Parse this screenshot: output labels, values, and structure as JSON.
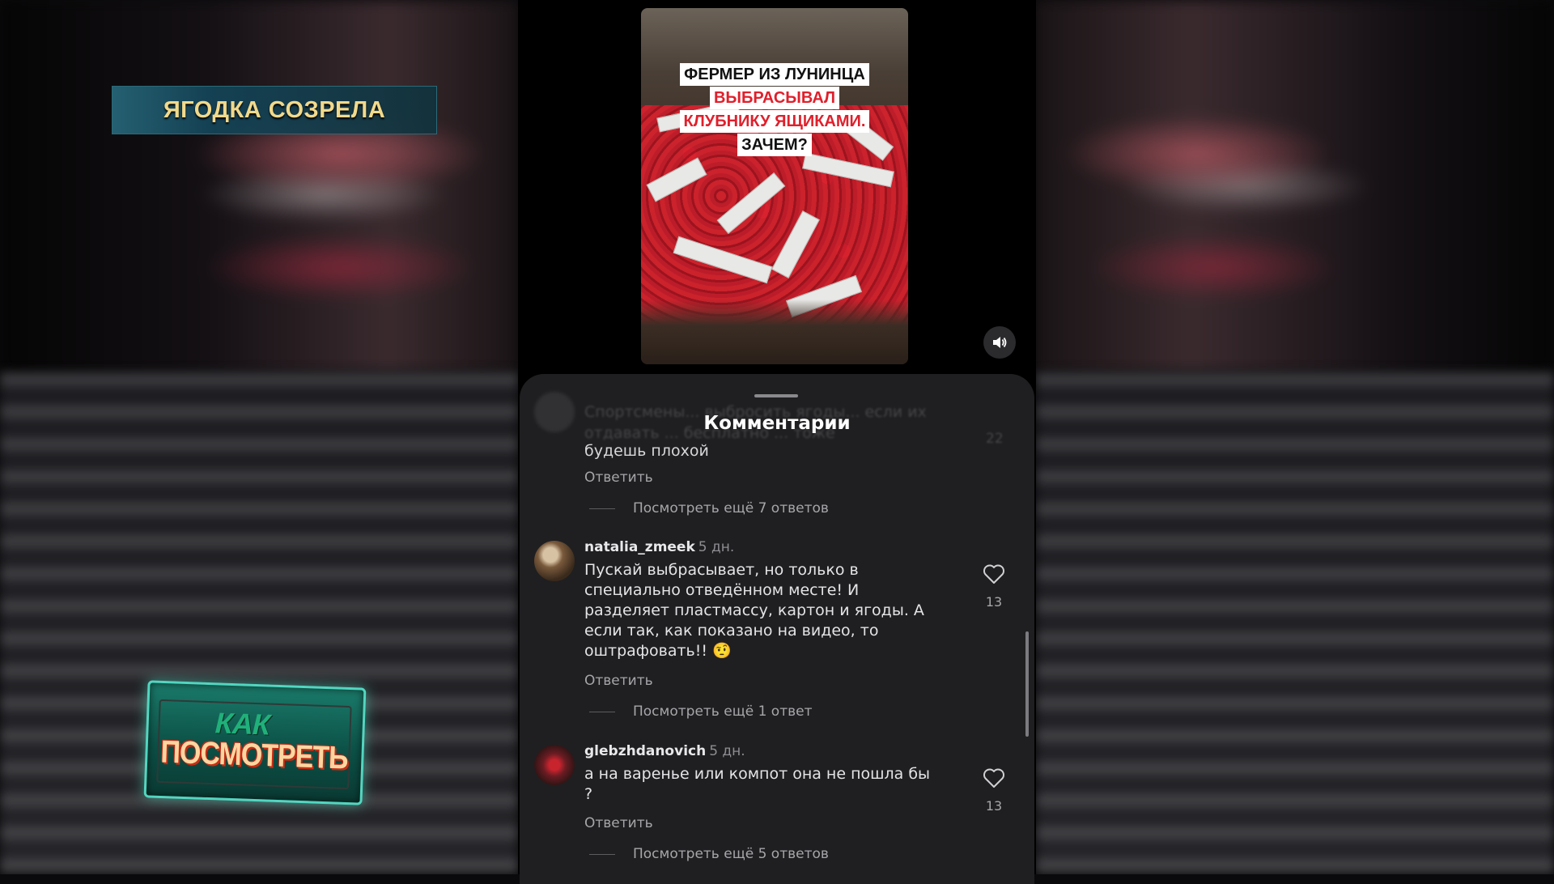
{
  "overlay": {
    "banner_text": "ЯГОДКА СОЗРЕЛА",
    "logo_top": "КАК",
    "logo_bottom": "ПОСМОТРЕТЬ"
  },
  "video": {
    "caption_line1": "ФЕРМЕР ИЗ ЛУНИНЦА",
    "caption_line2": "ВЫБРАСЫВАЛ",
    "caption_line3": "КЛУБНИКУ ЯЩИКАМИ.",
    "caption_line4": "ЗАЧЕМ?",
    "sound_icon": "speaker-icon"
  },
  "comments_sheet": {
    "title": "Комментарии",
    "prev_comment": {
      "faded_text": "Спортсмены... выбросить ягоды... если их отдавать ... бесплатно ... тоже",
      "visible_tail": "будешь плохой",
      "likes": "22",
      "reply_label": "Ответить",
      "more_replies": "Посмотреть ещё 7 ответов"
    },
    "comments": [
      {
        "username": "natalia_zmeek",
        "time": "5 дн.",
        "text": "Пускай выбрасывает, но только в специально отведённом месте!  И разделяет пластмассу, картон и ягоды. А если так, как показано на видео, то оштрафовать!! 🤨",
        "likes": "13",
        "reply_label": "Ответить",
        "more_replies": "Посмотреть ещё 1 ответ"
      },
      {
        "username": "glebzhdanovich",
        "time": "5 дн.",
        "text": "а на варенье или компот она не пошла бы ?",
        "likes": "13",
        "reply_label": "Ответить",
        "more_replies": "Посмотреть ещё 5 ответов"
      }
    ]
  },
  "colors": {
    "sheet_bg": "#1f1f21",
    "caption_red": "#e0202c",
    "banner_text": "#f1d98c"
  }
}
